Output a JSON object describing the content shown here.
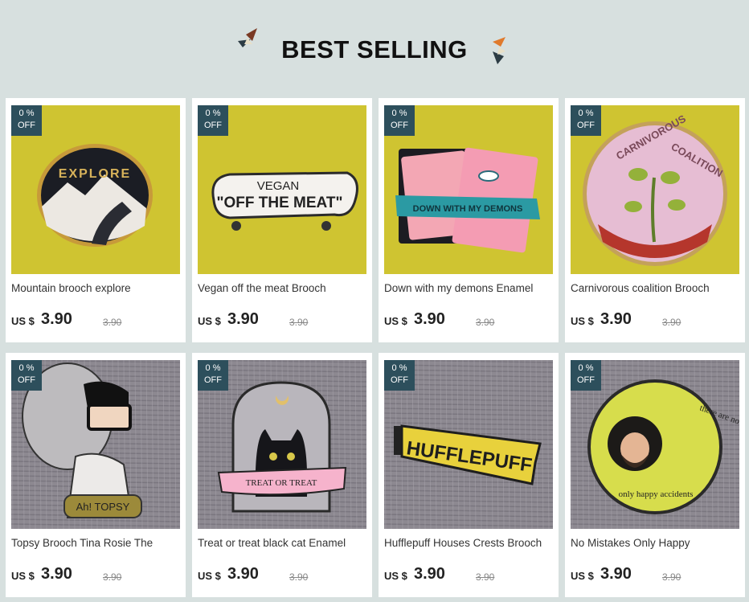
{
  "section": {
    "title": "BEST SELLING"
  },
  "colors": {
    "background": "#d7e0df",
    "badge": "#2d4f5c",
    "card": "#ffffff"
  },
  "products": [
    {
      "name": "Mountain brooch explore",
      "currency": "US $",
      "price": "3.90",
      "old_price": "3.90",
      "badge_pct": "0 %",
      "badge_off": "OFF",
      "art": "explore",
      "bg": "yellow"
    },
    {
      "name": "Vegan off the meat Brooch",
      "currency": "US $",
      "price": "3.90",
      "old_price": "3.90",
      "badge_pct": "0 %",
      "badge_off": "OFF",
      "art": "vegan",
      "bg": "yellow"
    },
    {
      "name": "Down with my demons Enamel",
      "currency": "US $",
      "price": "3.90",
      "old_price": "3.90",
      "badge_pct": "0 %",
      "badge_off": "OFF",
      "art": "demons",
      "bg": "yellow"
    },
    {
      "name": "Carnivorous coalition Brooch",
      "currency": "US $",
      "price": "3.90",
      "old_price": "3.90",
      "badge_pct": "0 %",
      "badge_off": "OFF",
      "art": "carnivorous",
      "bg": "yellow"
    },
    {
      "name": "Topsy Brooch Tina Rosie The",
      "currency": "US $",
      "price": "3.90",
      "old_price": "3.90",
      "badge_pct": "0 %",
      "badge_off": "OFF",
      "art": "topsy",
      "bg": "gray"
    },
    {
      "name": "Treat or treat black cat Enamel",
      "currency": "US $",
      "price": "3.90",
      "old_price": "3.90",
      "badge_pct": "0 %",
      "badge_off": "OFF",
      "art": "cat",
      "bg": "gray"
    },
    {
      "name": "Hufflepuff Houses Crests Brooch",
      "currency": "US $",
      "price": "3.90",
      "old_price": "3.90",
      "badge_pct": "0 %",
      "badge_off": "OFF",
      "art": "hufflepuff",
      "bg": "gray"
    },
    {
      "name": "No Mistakes Only Happy",
      "currency": "US $",
      "price": "3.90",
      "old_price": "3.90",
      "badge_pct": "0 %",
      "badge_off": "OFF",
      "art": "mistakes",
      "bg": "gray"
    }
  ],
  "pin_text": {
    "explore": "EXPLORE",
    "vegan_top": "VEGAN",
    "vegan_main": "\"OFF THE MEAT\"",
    "demons": "DOWN WITH MY DEMONS",
    "carnivorous_left": "CARNIVOROUS",
    "carnivorous_right": "COALITION",
    "topsy": "Ah! TOPSY",
    "cat": "TREAT OR TREAT",
    "hufflepuff": "HUFFLEPUFF",
    "mistakes_top": "there are no mistakes",
    "mistakes_bottom": "only happy accidents"
  }
}
